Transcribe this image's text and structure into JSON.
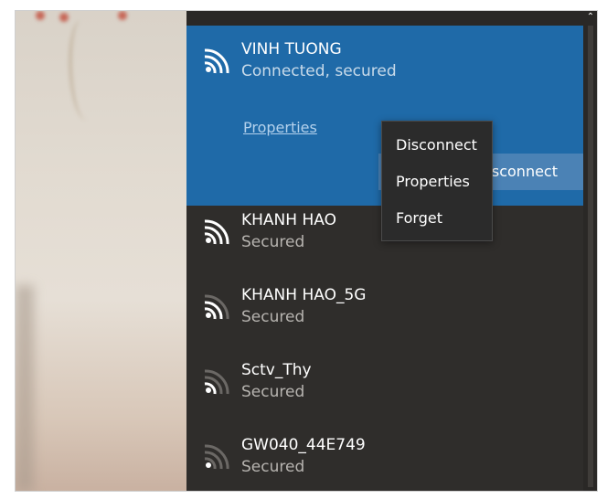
{
  "connected_network": {
    "ssid": "VINH TUONG",
    "status": "Connected, secured",
    "properties_link": "Properties",
    "disconnect_button": "Disconnect"
  },
  "networks": [
    {
      "ssid": "KHANH HAO",
      "status": "Secured",
      "signal_bars": 4
    },
    {
      "ssid": "KHANH HAO_5G",
      "status": "Secured",
      "signal_bars": 3
    },
    {
      "ssid": "Sctv_Thy",
      "status": "Secured",
      "signal_bars": 2
    },
    {
      "ssid": "GW040_44E749",
      "status": "Secured",
      "signal_bars": 1
    }
  ],
  "context_menu": {
    "items": [
      "Disconnect",
      "Properties",
      "Forget"
    ]
  },
  "colors": {
    "panel_bg": "#2f2d2b",
    "connected_bg": "#1f6aa8",
    "accent_button": "#4b82b5"
  },
  "icons": {
    "wifi": "wifi-signal-icon",
    "scroll_up": "chevron-up-icon"
  }
}
